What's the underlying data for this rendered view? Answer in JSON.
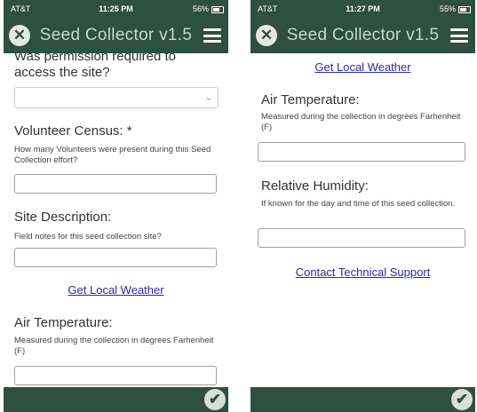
{
  "left": {
    "status": {
      "carrier": "AT&T",
      "time": "11:25 PM",
      "battery": "56%"
    },
    "title": "Seed Collector v1.5",
    "permission_label": "Was permission required to access the site?",
    "volunteer_label": "Volunteer Census: *",
    "volunteer_help": "How many Volunteers were present during this Seed Collection effort?",
    "site_label": "Site Description:",
    "site_help": "Field notes for this seed collection site?",
    "weather_link": "Get Local Weather",
    "air_label": "Air Temperature:",
    "air_help": "Measured during the collection in degrees Farhenheit (F)"
  },
  "right": {
    "status": {
      "carrier": "AT&T",
      "time": "11:27 PM",
      "battery": "55%"
    },
    "title": "Seed Collector v1.5",
    "weather_link": "Get Local Weather",
    "air_label": "Air Temperature:",
    "air_help": "Measured during the collection in degrees Farhenheit (F)",
    "humidity_label": "Relative Humidity:",
    "humidity_help": "If known for the day and time of this seed collection.",
    "support_link": "Contact Technical Support"
  },
  "icons": {
    "close": "close-icon",
    "menu": "menu-icon",
    "submit": "checkmark-icon",
    "dropdown": "chevron-down-icon"
  },
  "colors": {
    "bar": "#2f4f40",
    "title_text": "#c9d6ce",
    "link": "#2c2ca0"
  }
}
